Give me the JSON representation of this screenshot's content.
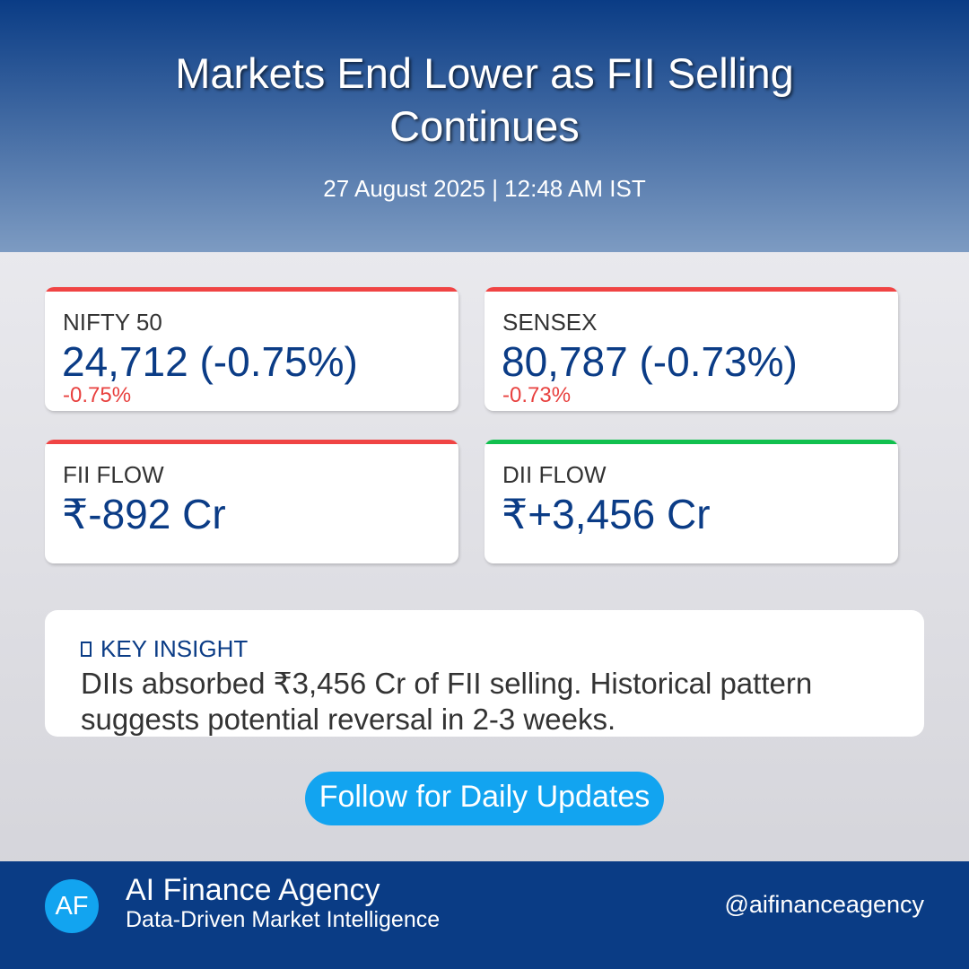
{
  "header": {
    "title": "Markets End Lower as FII Selling Continues",
    "dateline": "27 August 2025 | 12:48 AM IST"
  },
  "cards": [
    {
      "label": "NIFTY 50",
      "value": "24,712 (-0.75%)",
      "change": "-0.75%",
      "bar_color": "#f04444"
    },
    {
      "label": "SENSEX",
      "value": "80,787 (-0.73%)",
      "change": "-0.73%",
      "bar_color": "#f04444"
    },
    {
      "label": "FII FLOW",
      "value": "₹-892 Cr",
      "bar_color": "#f04444"
    },
    {
      "label": "DII FLOW",
      "value": "₹+3,456 Cr",
      "bar_color": "#11c04e"
    }
  ],
  "insight": {
    "icon": "box-icon",
    "title": "KEY INSIGHT",
    "body": "DIIs absorbed ₹3,456 Cr of FII selling. Historical pattern suggests potential reversal in 2-3 weeks."
  },
  "cta": {
    "label": "Follow for Daily Updates"
  },
  "footer": {
    "avatar_initials": "AF",
    "brand_name": "AI Finance Agency",
    "tagline": "Data-Driven Market Intelligence",
    "handle": "@aifinanceagency"
  },
  "colors": {
    "primary": "#0a3c85",
    "accent": "#12a4f0",
    "negative": "#e8413f",
    "positive": "#11c04e"
  }
}
